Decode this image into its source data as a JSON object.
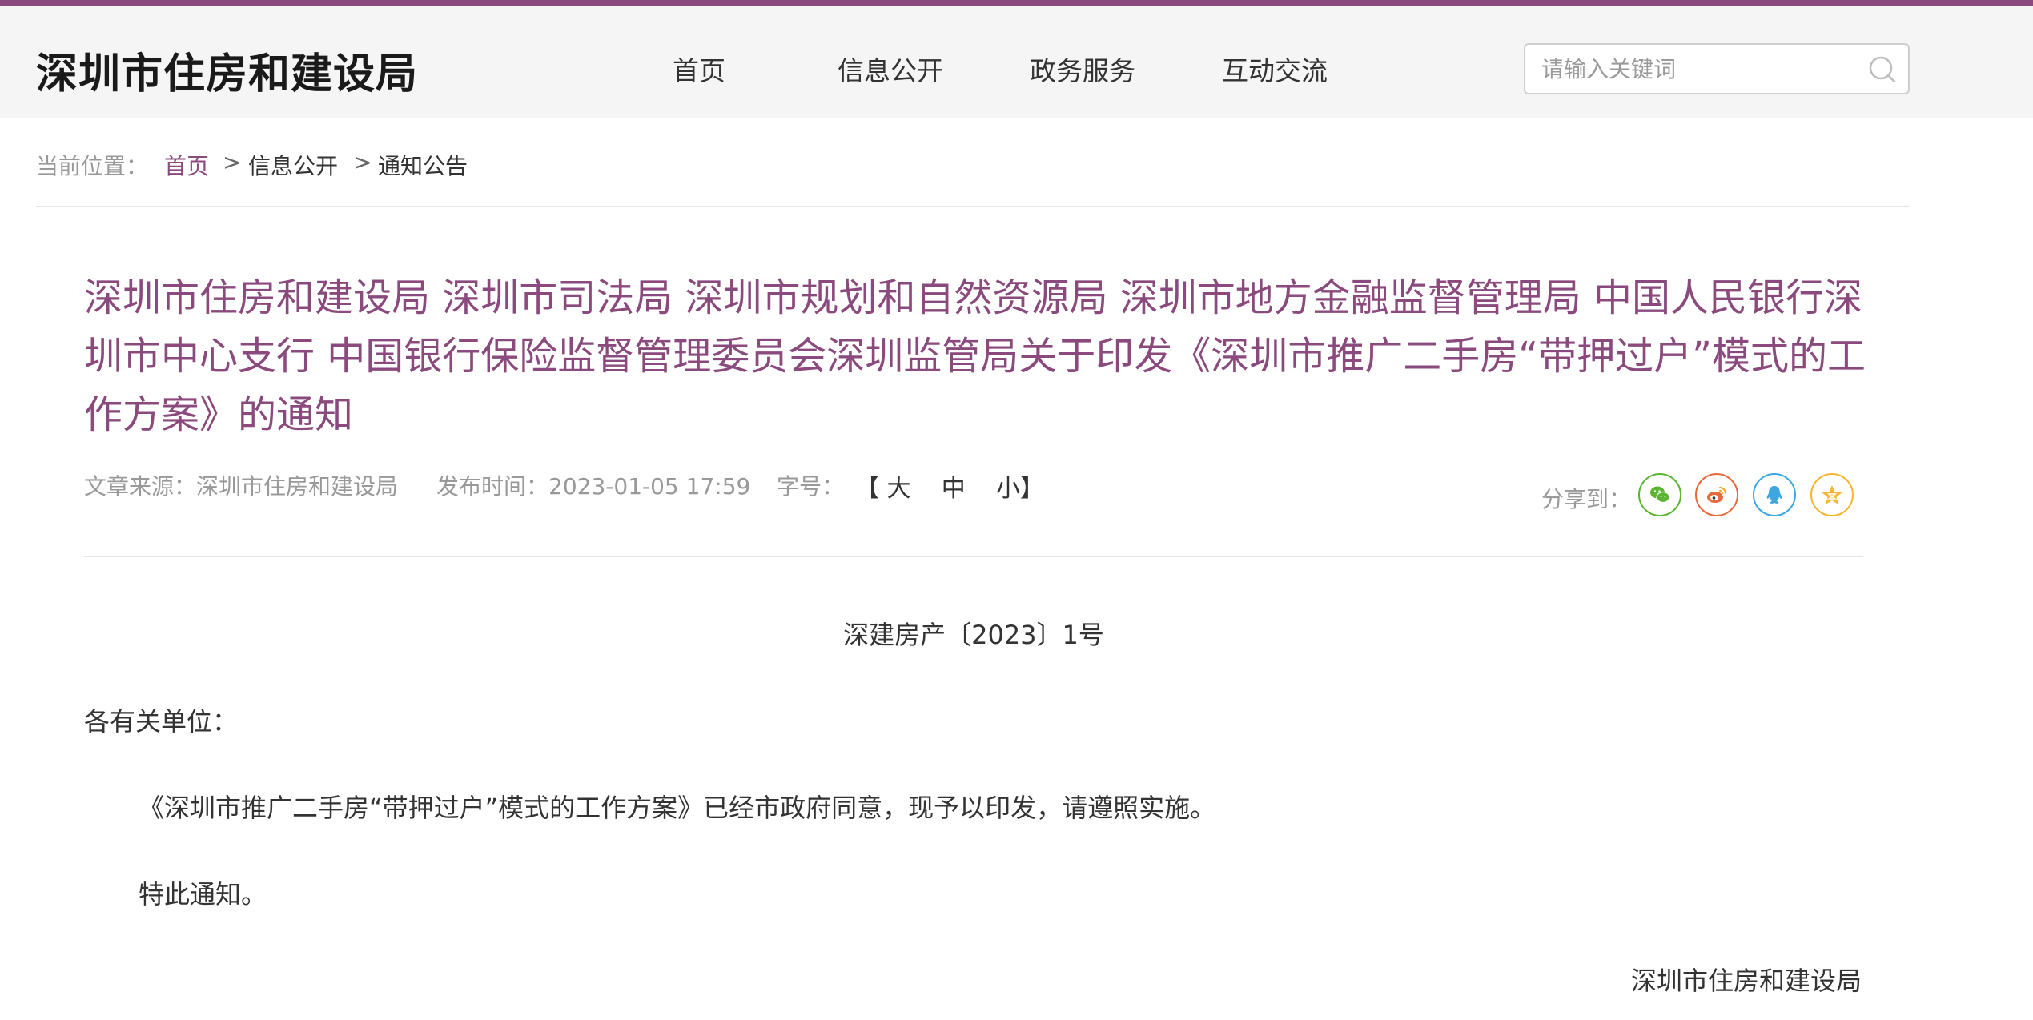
{
  "header": {
    "site_title": "深圳市住房和建设局",
    "nav": [
      "首页",
      "信息公开",
      "政务服务",
      "互动交流"
    ],
    "search_placeholder": "请输入关键词"
  },
  "breadcrumb": {
    "label": "当前位置：",
    "items": [
      "首页",
      "信息公开",
      "通知公告"
    ],
    "separator": ">"
  },
  "article": {
    "title": "深圳市住房和建设局 深圳市司法局 深圳市规划和自然资源局 深圳市地方金融监督管理局 中国人民银行深圳市中心支行 中国银行保险监督管理委员会深圳监管局关于印发《深圳市推广二手房“带押过户”模式的工作方案》的通知",
    "source_label": "文章来源：",
    "source": "深圳市住房和建设局",
    "date_label": "发布时间：",
    "date": "2023-01-05 17:59",
    "font_label": "字号：",
    "font_open": "【",
    "font_sizes": [
      "大",
      "中",
      "小"
    ],
    "font_close": "】",
    "share_label": "分享到：",
    "share_icons": [
      {
        "icon": "wechat-icon",
        "color": "#5cb531"
      },
      {
        "icon": "weibo-icon",
        "color": "#e8683c"
      },
      {
        "icon": "qq-icon",
        "color": "#3ea6e3"
      },
      {
        "icon": "qzone-icon",
        "color": "#f5b52e"
      }
    ]
  },
  "body": {
    "doc_number": "深建房产〔2023〕1号",
    "salutation": "各有关单位：",
    "paragraphs": [
      "《深圳市推广二手房“带押过户”模式的工作方案》已经市政府同意，现予以印发，请遵照实施。",
      "特此通知。"
    ],
    "signature": "深圳市住房和建设局"
  },
  "colors": {
    "accent": "#8b4a7d",
    "header_bg": "#f5f5f5"
  }
}
